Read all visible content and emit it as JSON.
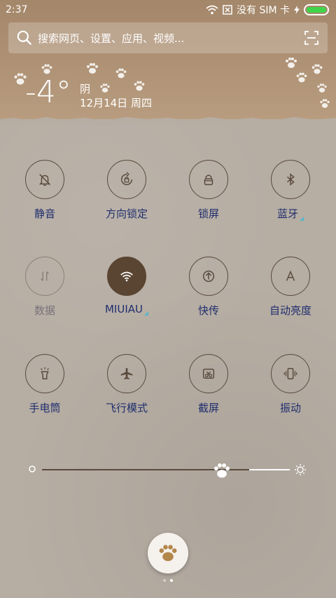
{
  "status_bar": {
    "time": "2:37",
    "carrier": "没有 SIM 卡",
    "wifi_icon": "wifi-icon",
    "sim_icon": "sim-icon",
    "battery_icon": "battery-charging-icon"
  },
  "search": {
    "placeholder": "搜索网页、设置、应用、视频..."
  },
  "weather": {
    "temperature": "-4°",
    "condition": "阴",
    "date": "12月14日 周四"
  },
  "toggles": [
    {
      "label": "静音",
      "icon": "mute-bell-icon",
      "state": "off"
    },
    {
      "label": "方向锁定",
      "icon": "rotation-lock-icon",
      "state": "off"
    },
    {
      "label": "锁屏",
      "icon": "lock-icon",
      "state": "off"
    },
    {
      "label": "蓝牙",
      "icon": "bluetooth-icon",
      "state": "off"
    },
    {
      "label": "数据",
      "icon": "mobile-data-icon",
      "state": "disabled"
    },
    {
      "label": "MIUIAU",
      "icon": "wifi-icon",
      "state": "on"
    },
    {
      "label": "快传",
      "icon": "quick-transfer-icon",
      "state": "off"
    },
    {
      "label": "自动亮度",
      "icon": "auto-brightness-icon",
      "state": "off"
    },
    {
      "label": "手电筒",
      "icon": "flashlight-icon",
      "state": "off"
    },
    {
      "label": "飞行模式",
      "icon": "airplane-icon",
      "state": "off"
    },
    {
      "label": "截屏",
      "icon": "screenshot-icon",
      "state": "off"
    },
    {
      "label": "振动",
      "icon": "vibrate-icon",
      "state": "off"
    }
  ],
  "brightness": {
    "level": 0.73,
    "min_icon": "brightness-low-icon",
    "max_icon": "brightness-high-icon"
  },
  "paw_button": {
    "icon": "paw-icon"
  },
  "page_indicator": {
    "pages": 2,
    "current": 2
  },
  "colors": {
    "accent": "#5a4532",
    "label": "#1f2e6e",
    "battery": "#3fd54a"
  }
}
